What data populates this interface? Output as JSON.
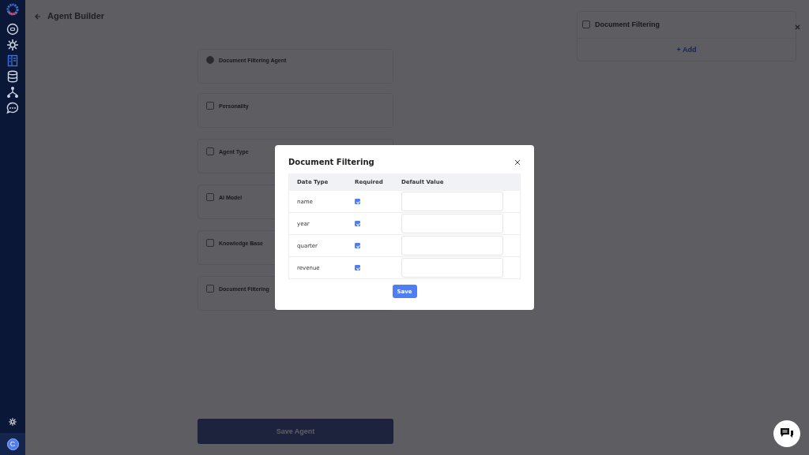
{
  "sidebar": {
    "items": [
      {
        "kind": "chat",
        "selected": false
      },
      {
        "kind": "gear",
        "selected": false
      },
      {
        "kind": "layout",
        "selected": true
      },
      {
        "kind": "database",
        "selected": false
      },
      {
        "kind": "hierarchy",
        "selected": false
      },
      {
        "kind": "message",
        "selected": false
      }
    ],
    "avatar": "C"
  },
  "page": {
    "title": "Agent Builder",
    "agent_name": "Document Filtering Agent",
    "sections": [
      {
        "title": "Personality"
      },
      {
        "title": "Agent Type"
      },
      {
        "title": "AI Model"
      },
      {
        "title": "Knowledge Base"
      },
      {
        "title": "Document Filtering"
      }
    ],
    "save_button": "Save Agent"
  },
  "side_panel": {
    "title": "Document Filtering",
    "add_button": "+ Add"
  },
  "modal": {
    "title": "Document Filtering",
    "columns": [
      "Date Type",
      "Required",
      "Default Value"
    ],
    "rows": [
      {
        "name": "name",
        "required": true
      },
      {
        "name": "year",
        "required": true
      },
      {
        "name": "quarter",
        "required": true
      },
      {
        "name": "revenue",
        "required": true
      }
    ],
    "save_button": "Save"
  }
}
